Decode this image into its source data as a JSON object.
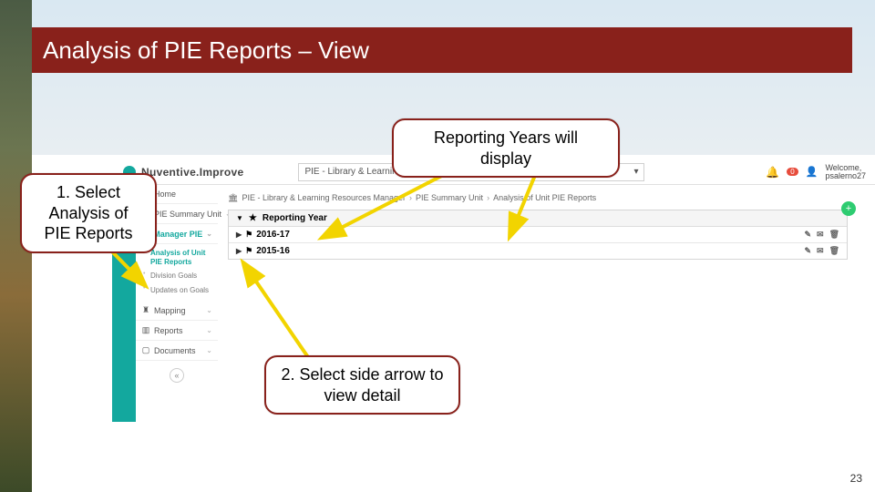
{
  "title": "Analysis of PIE Reports – View",
  "callouts": {
    "c1": "1. Select Analysis of PIE Reports",
    "c2": "Reporting Years will display",
    "c3": "2. Select side arrow to view detail"
  },
  "app": {
    "brand_prefix": "Nuventive.",
    "brand_suffix": "Improve",
    "header_select": "PIE - Library & Learning Resources Manager",
    "notif_count": "0",
    "welcome_label": "Welcome,",
    "welcome_user": "psalerno27"
  },
  "breadcrumb": {
    "b1": "PIE - Library & Learning Resources Manager",
    "b2": "PIE Summary Unit",
    "b3": "Analysis of Unit PIE Reports"
  },
  "sidebar": {
    "home": "Home",
    "summary_unit": "PIE Summary Unit",
    "manager_pie": "Manager PIE",
    "sub_analysis": "Analysis of Unit PIE Reports",
    "sub_division": "Division Goals",
    "sub_updates": "Updates on Goals",
    "mapping": "Mapping",
    "reports": "Reports",
    "documents": "Documents"
  },
  "panel": {
    "heading": "Reporting Year",
    "rows": [
      {
        "year": "2016-17"
      },
      {
        "year": "2015-16"
      }
    ]
  },
  "page_number": "23"
}
